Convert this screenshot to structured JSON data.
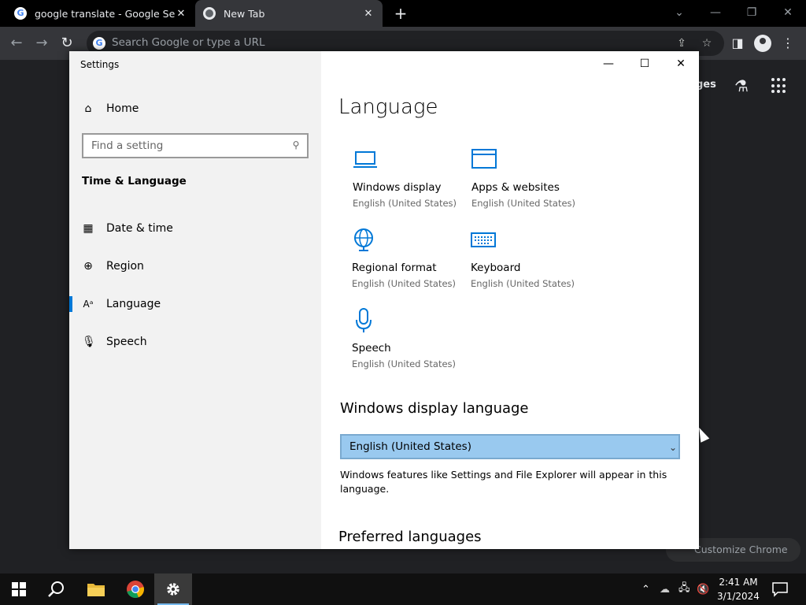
{
  "browser": {
    "tabs": [
      {
        "title": "google translate - Google Search",
        "active": false
      },
      {
        "title": "New Tab",
        "active": true
      }
    ],
    "omnibox_placeholder": "Search Google or type a URL",
    "ntp_partial_text": "ges",
    "customize_label": "Customize Chrome"
  },
  "settings": {
    "window_title": "Settings",
    "home_label": "Home",
    "search_placeholder": "Find a setting",
    "section_heading": "Time & Language",
    "nav_items": [
      {
        "label": "Date & time",
        "icon": "calendar-clock-icon",
        "selected": false
      },
      {
        "label": "Region",
        "icon": "globe-icon",
        "selected": false
      },
      {
        "label": "Language",
        "icon": "language-icon",
        "selected": true
      },
      {
        "label": "Speech",
        "icon": "microphone-icon",
        "selected": false
      }
    ],
    "page_title": "Language",
    "tiles": [
      {
        "label": "Windows display",
        "sub": "English (United States)",
        "icon": "laptop-icon"
      },
      {
        "label": "Apps & websites",
        "sub": "English (United States)",
        "icon": "window-icon"
      },
      {
        "label": "Regional format",
        "sub": "English (United States)",
        "icon": "globe-icon"
      },
      {
        "label": "Keyboard",
        "sub": "English (United States)",
        "icon": "keyboard-icon"
      },
      {
        "label": "Speech",
        "sub": "English (United States)",
        "icon": "microphone-icon"
      }
    ],
    "display_language_heading": "Windows display language",
    "display_language_value": "English (United States)",
    "display_language_desc": "Windows features like Settings and File Explorer will appear in this language.",
    "preferred_heading": "Preferred languages",
    "accent_color": "#0078d7"
  },
  "taskbar": {
    "time": "2:41 AM",
    "date": "3/1/2024"
  }
}
